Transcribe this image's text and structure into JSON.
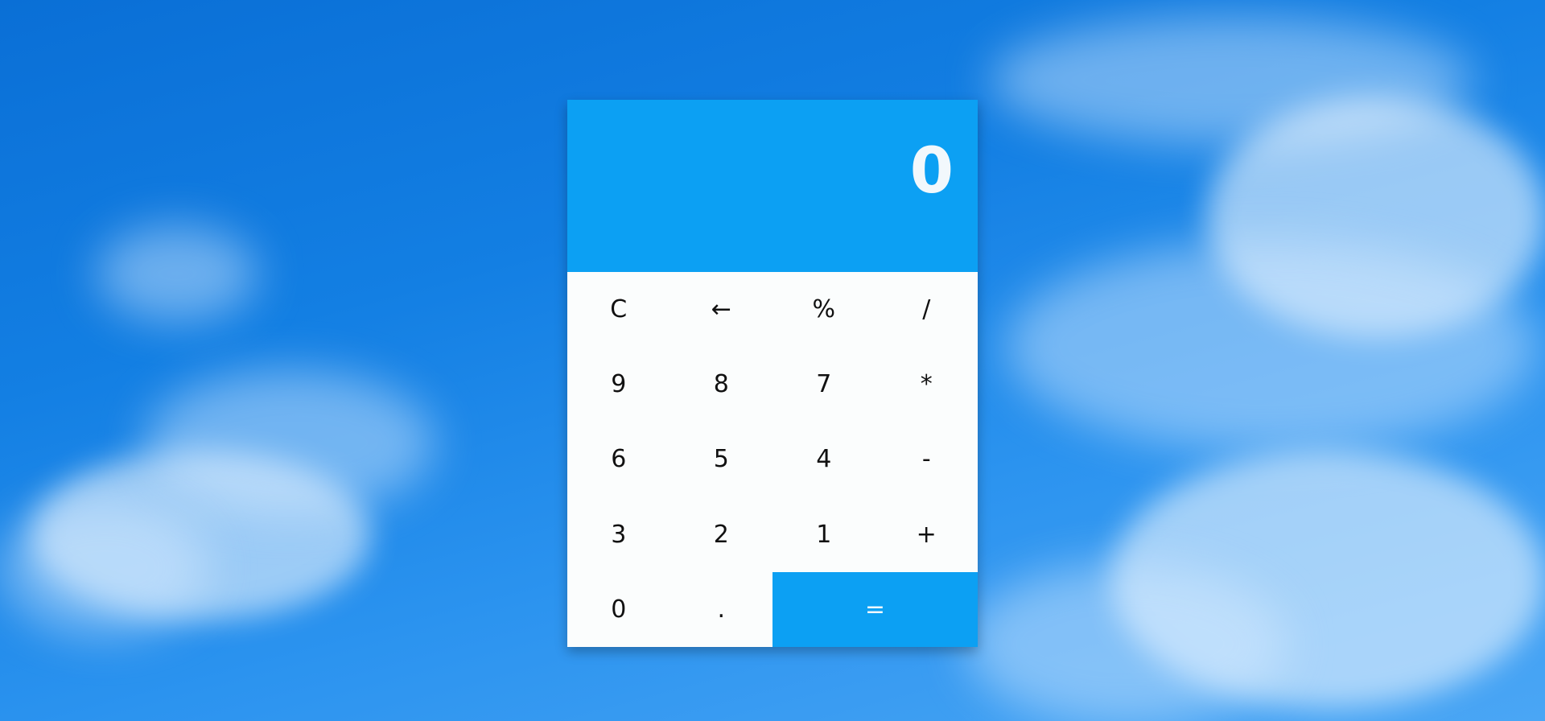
{
  "display": {
    "value": "0"
  },
  "keys": {
    "clear": "C",
    "backspace": "←",
    "percent": "%",
    "divide": "/",
    "nine": "9",
    "eight": "8",
    "seven": "7",
    "multiply": "*",
    "six": "6",
    "five": "5",
    "four": "4",
    "subtract": "-",
    "three": "3",
    "two": "2",
    "one": "1",
    "add": "+",
    "zero": "0",
    "decimal": ".",
    "equals": "="
  },
  "colors": {
    "accent": "#0ca0f3",
    "keypad_bg": "#fbfdfd",
    "key_text": "#111111",
    "display_text": "#f2f8fc"
  }
}
